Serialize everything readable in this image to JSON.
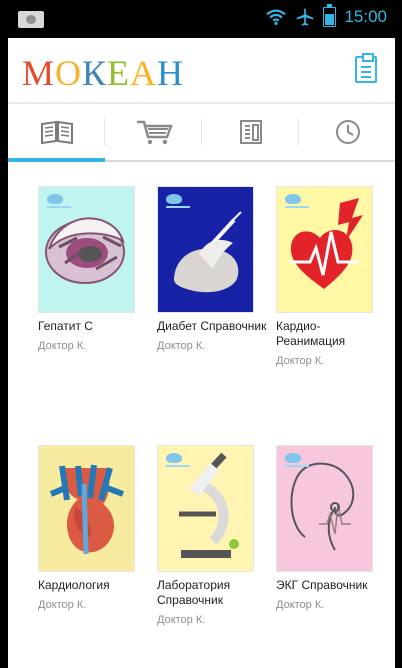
{
  "status": {
    "time": "15:00",
    "icons": [
      "image-icon",
      "wifi-icon",
      "airplane-icon",
      "battery-icon"
    ]
  },
  "app": {
    "logo": "МОКЕАН",
    "logo_colors": [
      "#e34b2c",
      "#f1b42b",
      "#3f86b5",
      "#8fbf2b",
      "#ffb11c",
      "#2a8fcf"
    ]
  },
  "tabs": [
    {
      "icon": "book-icon"
    },
    {
      "icon": "cart-icon"
    },
    {
      "icon": "catalog-icon"
    },
    {
      "icon": "clock-icon"
    }
  ],
  "books": [
    {
      "title": "Гепатит С",
      "author": "Доктор К.",
      "cover": "hepatitis"
    },
    {
      "title": "Диабет Справочник",
      "author": "Доктор К.",
      "cover": "diabetes"
    },
    {
      "title": "Кардио-Реанимация",
      "author": "Доктор К.",
      "cover": "heart"
    },
    {
      "title": "Кардиология",
      "author": "Доктор К.",
      "cover": "cardiology"
    },
    {
      "title": "Лаборатория Справочник",
      "author": "Доктор К.",
      "cover": "lab"
    },
    {
      "title": "ЭКГ Справочник",
      "author": "Доктор К.",
      "cover": "ecg"
    }
  ],
  "colors": {
    "accent": "#33b5e5",
    "muted": "#8e8e8e"
  }
}
